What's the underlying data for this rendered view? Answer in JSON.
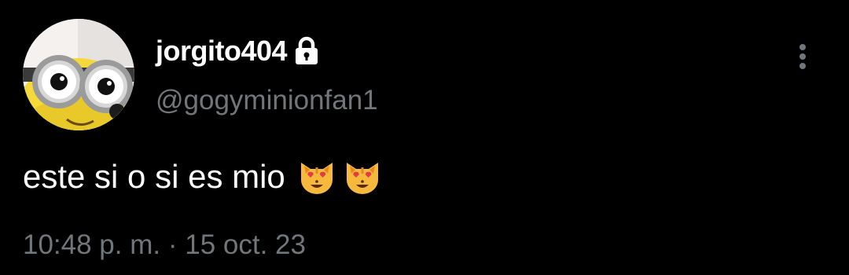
{
  "tweet": {
    "display_name": "jorgito404",
    "handle": "@gogyminionfan1",
    "text": "este si o si es mio",
    "emojis": [
      "smiling-cat-heart-eyes-emoji",
      "smiling-cat-heart-eyes-emoji"
    ],
    "time": "10:48 p. m.",
    "separator": "·",
    "date": "15 oct. 23",
    "protected_icon": "lock-icon",
    "more_icon": "more-vertical-icon",
    "avatar": "minion-goggles-avatar"
  },
  "colors": {
    "background": "#000000",
    "primary_text": "#ffffff",
    "secondary_text": "#71767b"
  }
}
